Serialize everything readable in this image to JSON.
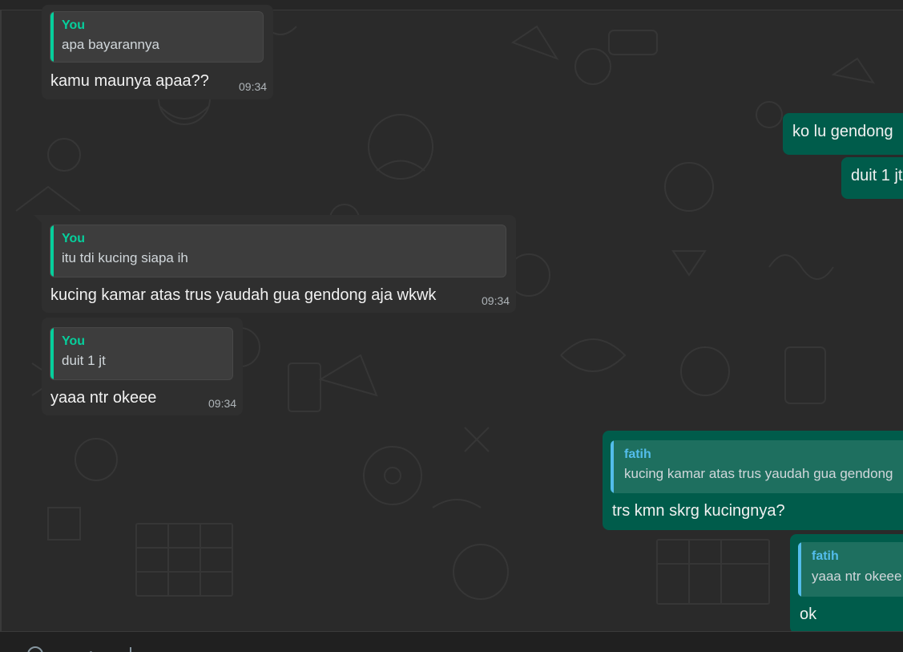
{
  "messages": [
    {
      "direction": "in",
      "quote_author": "You",
      "quote_text": "apa bayarannya",
      "text": "kamu maunya apaa??",
      "time": "09:34"
    },
    {
      "direction": "out",
      "text": "ko lu gendong"
    },
    {
      "direction": "out",
      "text": "duit 1 jt"
    },
    {
      "direction": "in",
      "quote_author": "You",
      "quote_text": "itu tdi kucing siapa ih",
      "text": "kucing kamar atas trus yaudah gua gendong aja wkwk",
      "time": "09:34"
    },
    {
      "direction": "in",
      "quote_author": "You",
      "quote_text": "duit 1 jt",
      "text": "yaaa ntr okeee",
      "time": "09:34"
    },
    {
      "direction": "out",
      "quote_author": "fatih",
      "quote_text": "kucing kamar atas trus yaudah gua gendong",
      "text": "trs kmn skrg kucingnya?"
    },
    {
      "direction": "out",
      "quote_author": "fatih",
      "quote_text": "yaaa ntr okeee",
      "text": "ok"
    }
  ],
  "colors": {
    "incoming_bubble": "#2f2f2f",
    "outgoing_bubble": "#005c4b",
    "own_quote_accent": "#06cf9c",
    "contact_quote_accent": "#53bdeb",
    "wallpaper": "#2a2a2a"
  },
  "icons": [
    "emoji-icon"
  ]
}
